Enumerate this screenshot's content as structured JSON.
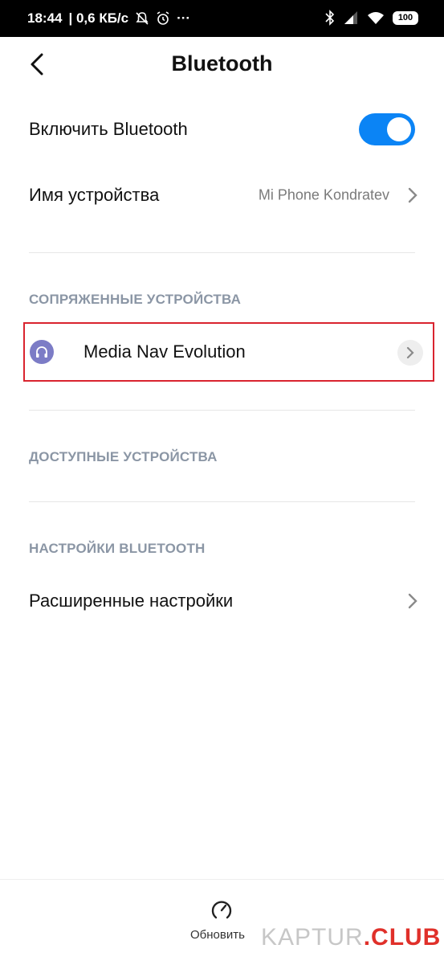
{
  "status_bar": {
    "time": "18:44",
    "speed": "| 0,6 КБ/с",
    "more": "···",
    "battery": "100"
  },
  "header": {
    "title": "Bluetooth"
  },
  "settings": {
    "enable_label": "Включить Bluetooth",
    "enable_state": true,
    "device_name_label": "Имя устройства",
    "device_name_value": "Mi Phone Kondratev"
  },
  "paired": {
    "header": "СОПРЯЖЕННЫЕ УСТРОЙСТВА",
    "devices": [
      {
        "name": "Media Nav Evolution",
        "icon": "headphones-icon"
      }
    ]
  },
  "available": {
    "header": "ДОСТУПНЫЕ УСТРОЙСТВА"
  },
  "bt_settings": {
    "header": "НАСТРОЙКИ BLUETOOTH",
    "advanced_label": "Расширенные настройки"
  },
  "bottom": {
    "refresh_label": "Обновить"
  },
  "watermark": {
    "part1": "KAPTUR",
    "part2": ".CLUB"
  },
  "colors": {
    "accent": "#0b84f5",
    "highlight_border": "#d9242f",
    "section_header": "#8b96a5",
    "device_icon_bg": "#7c7cc6"
  }
}
